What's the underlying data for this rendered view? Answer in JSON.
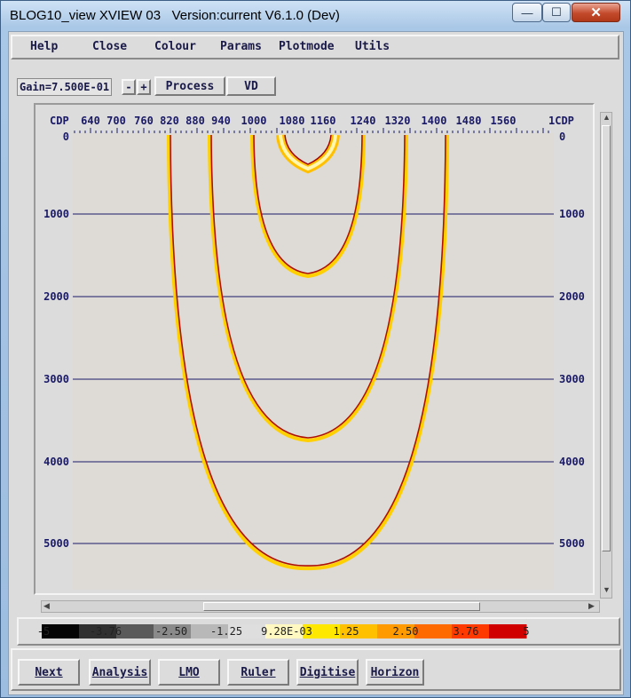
{
  "window": {
    "title": "BLOG10_view XVIEW 03   Version:current V6.1.0 (Dev)",
    "minimize_glyph": "—",
    "maximize_glyph": "☐",
    "close_glyph": "✕"
  },
  "menu": [
    "Help",
    "Close",
    "Colour",
    "Params",
    "Plotmode",
    "Utils"
  ],
  "toolbar": {
    "gain_label": "Gain=7.500E-01",
    "gain_minus": "-",
    "gain_plus": "+",
    "process_label": "Process",
    "vd_label": "VD"
  },
  "plot": {
    "axis_label_left": "CDP",
    "axis_label_right": "1CDP",
    "cdp_ticks": [
      "640",
      "700",
      "760",
      "820",
      "880",
      "940",
      "1000",
      "1080",
      "1160",
      "1240",
      "1320",
      "1400",
      "1480",
      "1560"
    ],
    "time_ticks": [
      "0",
      "1000",
      "2000",
      "3000",
      "4000",
      "5000"
    ],
    "background": "#dedbd6",
    "line_color": "#1a1a66"
  },
  "colorbar": {
    "labels": [
      "-5",
      "-3.76",
      "-2.50",
      "-1.25",
      "9.28E-03",
      "1.25",
      "2.50",
      "3.76",
      "5"
    ],
    "colors": [
      "#050505",
      "#303030",
      "#5a5a5a",
      "#8a8a8a",
      "#b8b8b8",
      "#dedede",
      "#fff8c0",
      "#ffe800",
      "#ffc000",
      "#ff9a00",
      "#ff6a00",
      "#ff3a00",
      "#d00000"
    ]
  },
  "footer": {
    "buttons": [
      "Next",
      "Analysis",
      "LMO",
      "Ruler",
      "Digitise",
      "Horizon"
    ]
  }
}
